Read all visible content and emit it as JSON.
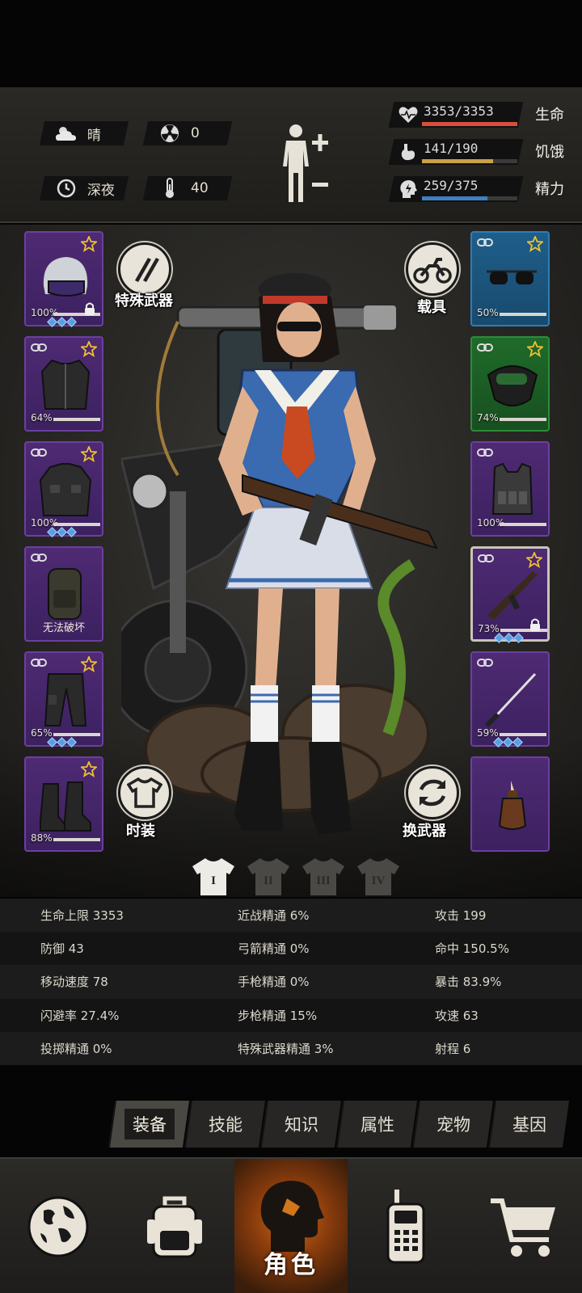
{
  "status": {
    "weather_label": "晴",
    "radiation_value": "0",
    "time_label": "深夜",
    "temperature_value": "40"
  },
  "vitals": {
    "health": {
      "value": "3353/3353",
      "label": "生命",
      "fraction": 1.0,
      "color": "#d94f3c"
    },
    "hunger": {
      "value": "141/190",
      "label": "饥饿",
      "fraction": 0.742,
      "color": "#c9a14a"
    },
    "energy": {
      "value": "259/375",
      "label": "精力",
      "fraction": 0.69,
      "color": "#3f7fc4"
    }
  },
  "buttons": {
    "special_weapon": "特殊武器",
    "vehicle": "载具",
    "fashion": "时装",
    "swap_weapon": "换武器"
  },
  "left_slots": [
    {
      "item": "police-helmet",
      "percent": "100%",
      "note": ""
    },
    {
      "item": "jacket",
      "percent": "64%",
      "note": ""
    },
    {
      "item": "tactical-coat",
      "percent": "100%",
      "note": ""
    },
    {
      "item": "backpack",
      "percent": "",
      "note": "无法破坏"
    },
    {
      "item": "cargo-pants",
      "percent": "65%",
      "note": ""
    },
    {
      "item": "combat-boots",
      "percent": "88%",
      "note": ""
    }
  ],
  "right_slots": [
    {
      "item": "sunglasses",
      "percent": "50%"
    },
    {
      "item": "gas-mask",
      "percent": "74%"
    },
    {
      "item": "tactical-vest",
      "percent": "100%"
    },
    {
      "item": "assault-rifle",
      "percent": "73%"
    },
    {
      "item": "katana",
      "percent": "59%"
    },
    {
      "item": "molotov",
      "percent": ""
    }
  ],
  "outfit_tabs": [
    "I",
    "II",
    "III",
    "IV"
  ],
  "stats": [
    [
      "生命上限 3353",
      "近战精通 6%",
      "攻击 199"
    ],
    [
      "防御 43",
      "弓箭精通 0%",
      "命中 150.5%"
    ],
    [
      "移动速度 78",
      "手枪精通 0%",
      "暴击 83.9%"
    ],
    [
      "闪避率 27.4%",
      "步枪精通 15%",
      "攻速 63"
    ],
    [
      "投掷精通 0%",
      "特殊武器精通 3%",
      "射程 6"
    ]
  ],
  "subtabs": [
    "装备",
    "技能",
    "知识",
    "属性",
    "宠物",
    "基因"
  ],
  "nav": {
    "active_label": "角色"
  },
  "colors": {
    "epic_purple": "#4e2a73",
    "rare_blue": "#1e5e8a",
    "uncommon_green": "#1f6b2a",
    "accent_orange": "#c86a1a"
  }
}
